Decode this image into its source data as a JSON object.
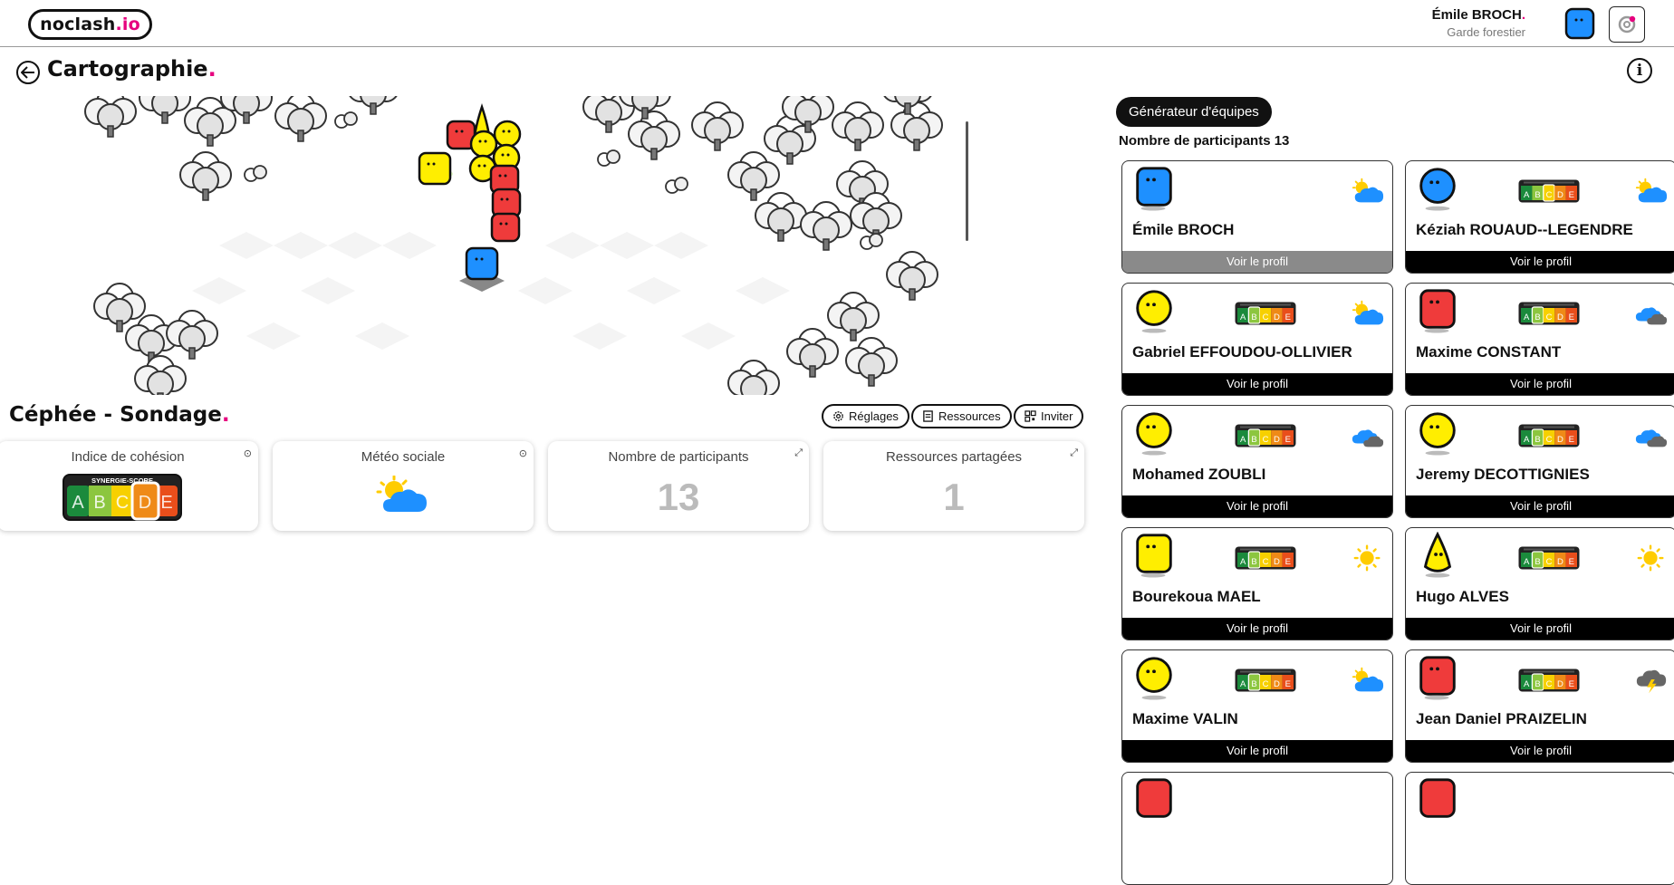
{
  "app": {
    "logo_text": "noclash",
    "logo_suffix": ".io"
  },
  "user": {
    "name": "Émile BROCH",
    "role": "Garde forestier"
  },
  "page": {
    "title": "Cartographie"
  },
  "study": {
    "title": "Céphée - Sondage",
    "buttons": {
      "settings": "Réglages",
      "resources": "Ressources",
      "invite": "Inviter"
    },
    "metrics": {
      "cohesion": {
        "label": "Indice de cohésion",
        "score_header": "SYNERGIE-SCORE",
        "letters": [
          "A",
          "B",
          "C",
          "D",
          "E"
        ],
        "selected": "D"
      },
      "weather": {
        "label": "Météo sociale",
        "icon": "sun-cloud-icon"
      },
      "participants": {
        "label": "Nombre de participants",
        "value": "13"
      },
      "resources": {
        "label": "Ressources partagées",
        "value": "1"
      }
    }
  },
  "panel": {
    "generator_label": "Générateur d'équipes",
    "count_label": "Nombre de participants 13",
    "profile_label": "Voir le profil",
    "participants": [
      {
        "name": "Émile BROCH",
        "avatar": "blue-square",
        "score": null,
        "weather": "sun-cloud"
      },
      {
        "name": "Kéziah ROUAUD--LEGENDRE",
        "avatar": "blue-circle",
        "score": "C",
        "weather": "sun-cloud"
      },
      {
        "name": "Gabriel EFFOUDOU-OLLIVIER",
        "avatar": "yellow-circle",
        "score": "B",
        "weather": "sun-cloud"
      },
      {
        "name": "Maxime CONSTANT",
        "avatar": "red-square",
        "score": "B",
        "weather": "clouds"
      },
      {
        "name": "Mohamed ZOUBLI",
        "avatar": "yellow-circle",
        "score": "B",
        "weather": "clouds"
      },
      {
        "name": "Jeremy DECOTTIGNIES",
        "avatar": "yellow-circle",
        "score": "B",
        "weather": "clouds"
      },
      {
        "name": "Bourekoua MAEL",
        "avatar": "yellow-square",
        "score": "B",
        "weather": "sun"
      },
      {
        "name": "Hugo ALVES",
        "avatar": "yellow-drop",
        "score": "B",
        "weather": "sun"
      },
      {
        "name": "Maxime VALIN",
        "avatar": "yellow-circle",
        "score": "B",
        "weather": "sun-cloud"
      },
      {
        "name": "Jean Daniel PRAIZELIN",
        "avatar": "red-square",
        "score": "B",
        "weather": "storm"
      }
    ]
  },
  "colors": {
    "accent": "#e6007e",
    "blue": "#1e90ff",
    "yellow": "#ffee00",
    "red": "#ef3b3b"
  }
}
